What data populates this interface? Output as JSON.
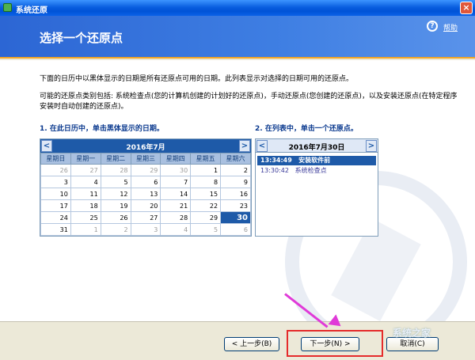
{
  "window": {
    "title": "系统还原"
  },
  "header": {
    "page_title": "选择一个还原点",
    "help_icon": "?",
    "help_label": "帮助"
  },
  "intro": {
    "line1": "下面的日历中以黑体显示的日期是所有还原点可用的日期。此列表显示对选择的日期可用的还原点。",
    "line2": "可能的还原点类别包括: 系统检查点(您的计算机创建的计划好的还原点)，手动还原点(您创建的还原点)，以及安装还原点(在特定程序安装时自动创建的还原点)。"
  },
  "step1": "1. 在此日历中，单击黑体显示的日期。",
  "step2": "2. 在列表中，单击一个还原点。",
  "calendar": {
    "month_label": "2016年7月",
    "prev": "<",
    "next": ">",
    "weekdays": [
      "星期日",
      "星期一",
      "星期二",
      "星期三",
      "星期四",
      "星期五",
      "星期六"
    ],
    "weeks": [
      [
        "26",
        "27",
        "28",
        "29",
        "30",
        "1",
        "2"
      ],
      [
        "3",
        "4",
        "5",
        "6",
        "7",
        "8",
        "9"
      ],
      [
        "10",
        "11",
        "12",
        "13",
        "14",
        "15",
        "16"
      ],
      [
        "17",
        "18",
        "19",
        "20",
        "21",
        "22",
        "23"
      ],
      [
        "24",
        "25",
        "26",
        "27",
        "28",
        "29",
        "30"
      ],
      [
        "31",
        "1",
        "2",
        "3",
        "4",
        "5",
        "6"
      ]
    ],
    "selected": "30"
  },
  "restore_list": {
    "date_label": "2016年7月30日",
    "prev": "<",
    "next": ">",
    "items": [
      {
        "time": "13:34:49",
        "name": "安装软件前"
      },
      {
        "time": "13:30:42",
        "name": "系统检查点"
      }
    ]
  },
  "buttons": {
    "back": "< 上一步(B)",
    "next": "下一步(N) >",
    "cancel": "取消(C)"
  },
  "watermark": "系统之家",
  "colors": {
    "accent": "#1e5aa8",
    "banner": "#3f7fe3",
    "highlight": "#e52b2b",
    "arrow": "#e03ad8"
  }
}
